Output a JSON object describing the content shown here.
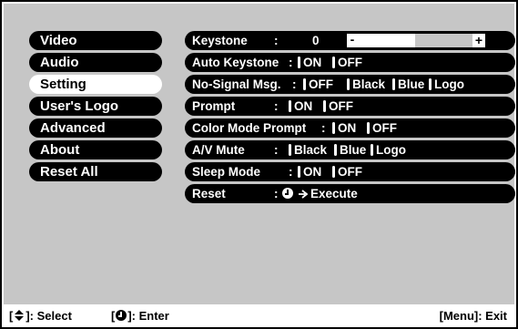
{
  "left_menu": {
    "items": [
      {
        "label": "Video",
        "selected": false
      },
      {
        "label": "Audio",
        "selected": false
      },
      {
        "label": "Setting",
        "selected": true
      },
      {
        "label": "User's Logo",
        "selected": false
      },
      {
        "label": "Advanced",
        "selected": false
      },
      {
        "label": "About",
        "selected": false
      },
      {
        "label": "Reset All",
        "selected": false
      }
    ]
  },
  "settings": {
    "keystone": {
      "label": "Keystone",
      "sep": ":",
      "value": "0",
      "minus": "-",
      "plus": "+",
      "level": 0.5
    },
    "auto_keystone": {
      "label": "Auto Keystone",
      "sep": ":",
      "options": [
        "ON",
        "OFF"
      ]
    },
    "no_signal": {
      "label": "No-Signal Msg.",
      "sep": ":",
      "options": [
        "OFF",
        "Black",
        "Blue",
        "Logo"
      ]
    },
    "prompt": {
      "label": "Prompt",
      "sep": ":",
      "options": [
        "ON",
        "OFF"
      ]
    },
    "color_mode_prompt": {
      "label": "Color Mode Prompt",
      "sep": ":",
      "options": [
        "ON",
        "OFF"
      ]
    },
    "av_mute": {
      "label": "A/V Mute",
      "sep": ":",
      "options": [
        "Black",
        "Blue",
        "Logo"
      ]
    },
    "sleep_mode": {
      "label": "Sleep Mode",
      "sep": ":",
      "options": [
        "ON",
        "OFF"
      ]
    },
    "reset": {
      "label": "Reset",
      "sep": ":",
      "action": "Execute"
    }
  },
  "footer": {
    "select": "]: Select",
    "enter": "]: Enter",
    "exit": "[Menu]: Exit",
    "bracket_open": "[",
    "bracket_open2": "["
  },
  "colors": {
    "panel": "#c6c6c6",
    "item_bg": "#000000",
    "item_text": "#ffffff",
    "selected_bg": "#ffffff"
  },
  "icons": {
    "select": "up-down-arrows-icon",
    "enter": "enter-knob-icon"
  }
}
